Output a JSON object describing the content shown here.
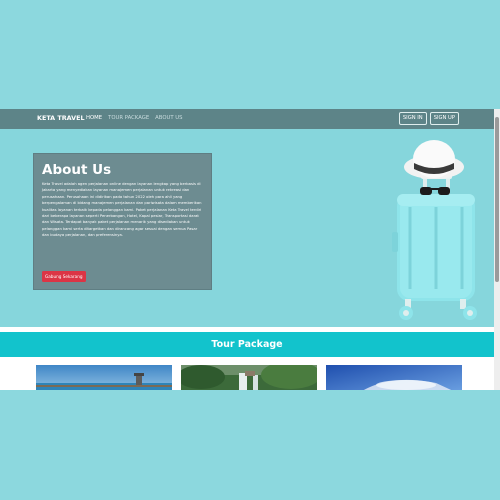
{
  "navbar": {
    "brand": "KETA TRAVEL",
    "links": [
      {
        "label": "HOME",
        "active": true
      },
      {
        "label": "TOUR PACKAGE",
        "active": false
      },
      {
        "label": "ABOUT US",
        "active": false
      }
    ],
    "sign_in": "SIGN IN",
    "sign_up": "SIGN UP"
  },
  "about": {
    "title": "About Us",
    "body": "Keta Travel adalah agen perjalanan online dengan layanan lengkap yang berbasis di Jakarta yang menyediakan layanan manajemen perjalanan untuk rekreasi dan perusahaan. Perusahaan ini didirikan pada tahun 2022 oleh para ahli yang berpengalaman di bidang manajemen perjalanan dan pariwisata dalam memberikan kualitas layanan terbaik kepada pelanggan kami. Paket perjalanan Keta Travel terdiri dari beberapa layanan seperti Penerbangan, Hotel, Kapal pesiar, Transportasi darat dan Wisata. Terdapat banyak paket perjalanan menarik yang disediakan untuk pelanggan kami serta ditargetkan dan dirancang agar sesuai dengan semua Pasar dan budaya perjalanan, dan preferensinya.",
    "cta": "Gabung Sekarang"
  },
  "tour": {
    "title": "Tour Package",
    "cards": [
      {
        "image": "beach-pier-photo"
      },
      {
        "image": "waterfall-forest-photo"
      },
      {
        "image": "blue-sky-clouds-photo"
      }
    ]
  },
  "colors": {
    "background": "#8cd8de",
    "navbar": "#5d8488",
    "card": "#6d8c91",
    "cta": "#dc3545",
    "tour_bar": "#12c3cc"
  }
}
